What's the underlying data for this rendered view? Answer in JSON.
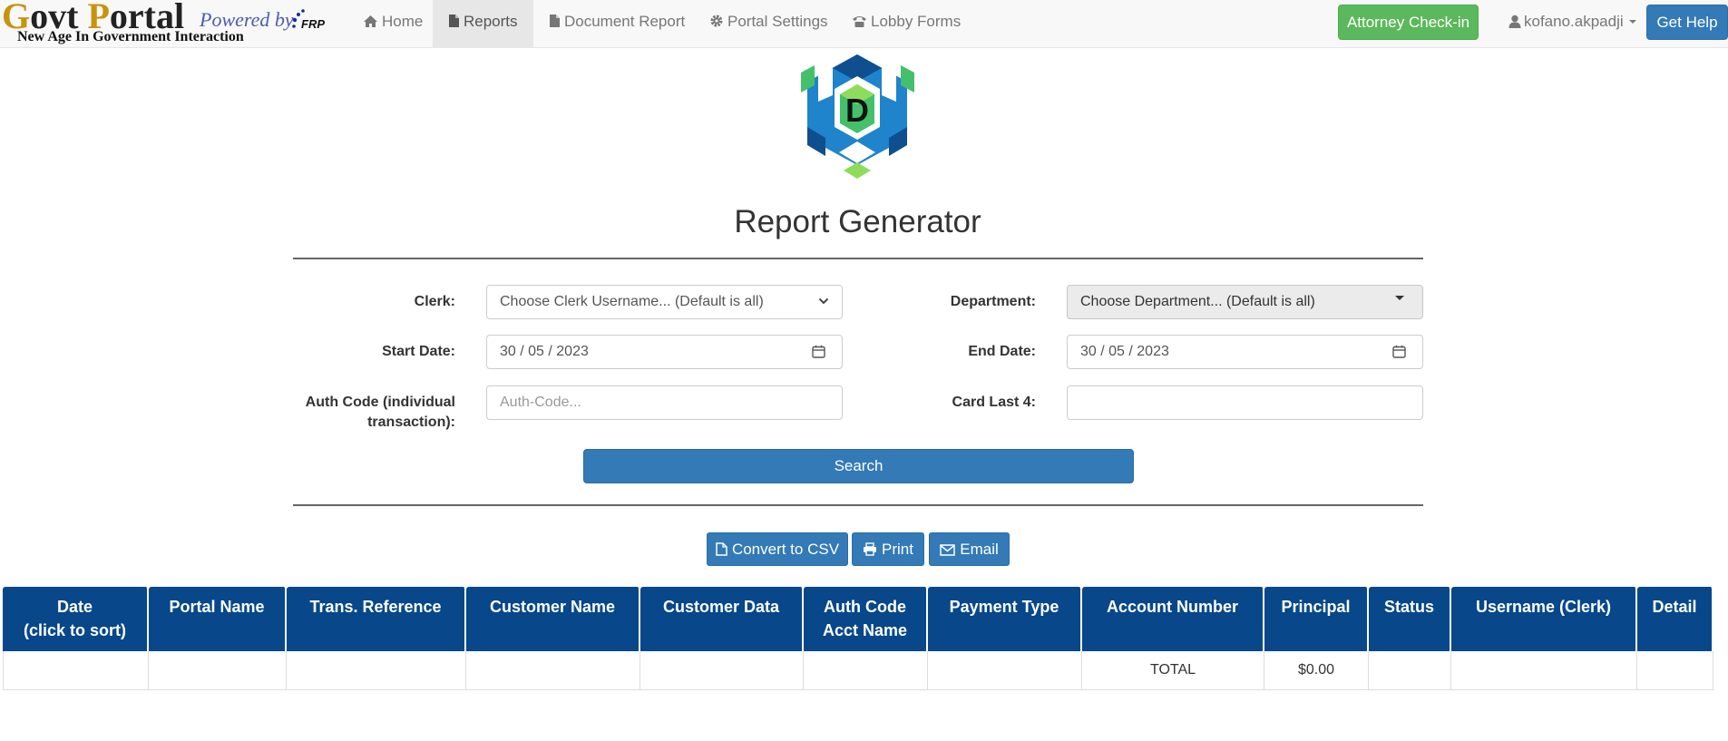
{
  "brand": {
    "title_g": "G",
    "title_ovt": "ovt ",
    "title_p": "P",
    "title_ortal": "ortal",
    "powered_by": "Powered by",
    "frp": "FRP",
    "tagline": "New Age In Government Interaction"
  },
  "nav": {
    "items": [
      {
        "label": "Home",
        "icon": "home-icon"
      },
      {
        "label": "Reports",
        "icon": "file-icon"
      },
      {
        "label": "Document Report",
        "icon": "file-icon"
      },
      {
        "label": "Portal Settings",
        "icon": "gear-icon"
      },
      {
        "label": "Lobby Forms",
        "icon": "phone-icon"
      }
    ],
    "active": "Reports",
    "checkin_label": "Attorney Check-in",
    "username": "kofano.akpadji",
    "help_label": "Get Help"
  },
  "logo": {
    "letter": "D"
  },
  "page": {
    "title": "Report Generator"
  },
  "form": {
    "clerk_label": "Clerk:",
    "clerk_value": "Choose Clerk Username... (Default is all)",
    "department_label": "Department:",
    "department_value": "Choose Department... (Default is all)",
    "start_label": "Start Date:",
    "start_value": "30 / 05 / 2023",
    "end_label": "End Date:",
    "end_value": "30 / 05 / 2023",
    "auth_label_line1": "Auth Code (individual",
    "auth_label_line2": "transaction):",
    "auth_placeholder": "Auth-Code...",
    "card_label": "Card Last 4:",
    "card_value": "",
    "search_label": "Search"
  },
  "tools": {
    "csv_label": "Convert to CSV",
    "print_label": "Print",
    "email_label": "Email"
  },
  "table": {
    "headers": [
      [
        "Date",
        "(click to sort)"
      ],
      [
        "Portal Name"
      ],
      [
        "Trans. Reference"
      ],
      [
        "Customer Name"
      ],
      [
        "Customer Data"
      ],
      [
        "Auth Code",
        "Acct Name"
      ],
      [
        "Payment Type"
      ],
      [
        "Account Number"
      ],
      [
        "Principal"
      ],
      [
        "Status"
      ],
      [
        "Username (Clerk)"
      ],
      [
        "Detail"
      ]
    ],
    "total_row": [
      "",
      "",
      "",
      "",
      "",
      "",
      "",
      "TOTAL",
      "$0.00",
      "",
      "",
      ""
    ]
  },
  "colors": {
    "primary": "#337ab7",
    "success": "#5cb85c",
    "table_header": "#07478a",
    "brand_gold": "#c8940c"
  }
}
